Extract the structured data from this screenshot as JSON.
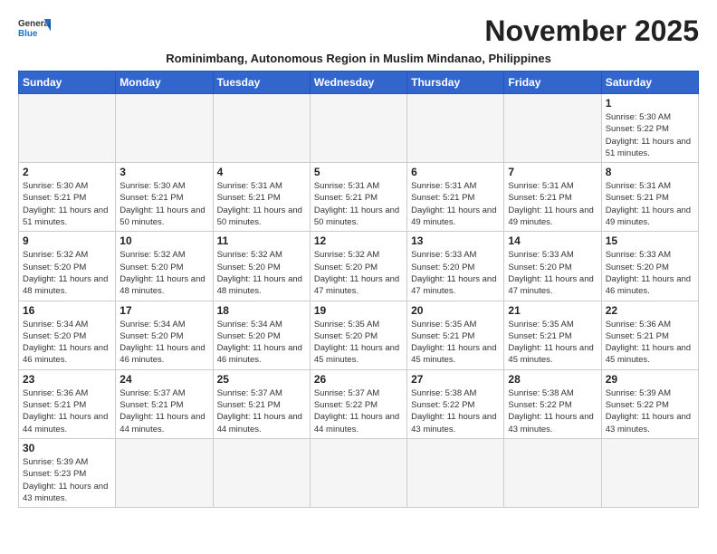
{
  "header": {
    "logo_general": "General",
    "logo_blue": "Blue",
    "month_title": "November 2025",
    "subtitle": "Rominimbang, Autonomous Region in Muslim Mindanao, Philippines"
  },
  "days_of_week": [
    "Sunday",
    "Monday",
    "Tuesday",
    "Wednesday",
    "Thursday",
    "Friday",
    "Saturday"
  ],
  "weeks": [
    [
      {
        "day": "",
        "info": ""
      },
      {
        "day": "",
        "info": ""
      },
      {
        "day": "",
        "info": ""
      },
      {
        "day": "",
        "info": ""
      },
      {
        "day": "",
        "info": ""
      },
      {
        "day": "",
        "info": ""
      },
      {
        "day": "1",
        "info": "Sunrise: 5:30 AM\nSunset: 5:22 PM\nDaylight: 11 hours and 51 minutes."
      }
    ],
    [
      {
        "day": "2",
        "info": "Sunrise: 5:30 AM\nSunset: 5:21 PM\nDaylight: 11 hours and 51 minutes."
      },
      {
        "day": "3",
        "info": "Sunrise: 5:30 AM\nSunset: 5:21 PM\nDaylight: 11 hours and 50 minutes."
      },
      {
        "day": "4",
        "info": "Sunrise: 5:31 AM\nSunset: 5:21 PM\nDaylight: 11 hours and 50 minutes."
      },
      {
        "day": "5",
        "info": "Sunrise: 5:31 AM\nSunset: 5:21 PM\nDaylight: 11 hours and 50 minutes."
      },
      {
        "day": "6",
        "info": "Sunrise: 5:31 AM\nSunset: 5:21 PM\nDaylight: 11 hours and 49 minutes."
      },
      {
        "day": "7",
        "info": "Sunrise: 5:31 AM\nSunset: 5:21 PM\nDaylight: 11 hours and 49 minutes."
      },
      {
        "day": "8",
        "info": "Sunrise: 5:31 AM\nSunset: 5:21 PM\nDaylight: 11 hours and 49 minutes."
      }
    ],
    [
      {
        "day": "9",
        "info": "Sunrise: 5:32 AM\nSunset: 5:20 PM\nDaylight: 11 hours and 48 minutes."
      },
      {
        "day": "10",
        "info": "Sunrise: 5:32 AM\nSunset: 5:20 PM\nDaylight: 11 hours and 48 minutes."
      },
      {
        "day": "11",
        "info": "Sunrise: 5:32 AM\nSunset: 5:20 PM\nDaylight: 11 hours and 48 minutes."
      },
      {
        "day": "12",
        "info": "Sunrise: 5:32 AM\nSunset: 5:20 PM\nDaylight: 11 hours and 47 minutes."
      },
      {
        "day": "13",
        "info": "Sunrise: 5:33 AM\nSunset: 5:20 PM\nDaylight: 11 hours and 47 minutes."
      },
      {
        "day": "14",
        "info": "Sunrise: 5:33 AM\nSunset: 5:20 PM\nDaylight: 11 hours and 47 minutes."
      },
      {
        "day": "15",
        "info": "Sunrise: 5:33 AM\nSunset: 5:20 PM\nDaylight: 11 hours and 46 minutes."
      }
    ],
    [
      {
        "day": "16",
        "info": "Sunrise: 5:34 AM\nSunset: 5:20 PM\nDaylight: 11 hours and 46 minutes."
      },
      {
        "day": "17",
        "info": "Sunrise: 5:34 AM\nSunset: 5:20 PM\nDaylight: 11 hours and 46 minutes."
      },
      {
        "day": "18",
        "info": "Sunrise: 5:34 AM\nSunset: 5:20 PM\nDaylight: 11 hours and 46 minutes."
      },
      {
        "day": "19",
        "info": "Sunrise: 5:35 AM\nSunset: 5:20 PM\nDaylight: 11 hours and 45 minutes."
      },
      {
        "day": "20",
        "info": "Sunrise: 5:35 AM\nSunset: 5:21 PM\nDaylight: 11 hours and 45 minutes."
      },
      {
        "day": "21",
        "info": "Sunrise: 5:35 AM\nSunset: 5:21 PM\nDaylight: 11 hours and 45 minutes."
      },
      {
        "day": "22",
        "info": "Sunrise: 5:36 AM\nSunset: 5:21 PM\nDaylight: 11 hours and 45 minutes."
      }
    ],
    [
      {
        "day": "23",
        "info": "Sunrise: 5:36 AM\nSunset: 5:21 PM\nDaylight: 11 hours and 44 minutes."
      },
      {
        "day": "24",
        "info": "Sunrise: 5:37 AM\nSunset: 5:21 PM\nDaylight: 11 hours and 44 minutes."
      },
      {
        "day": "25",
        "info": "Sunrise: 5:37 AM\nSunset: 5:21 PM\nDaylight: 11 hours and 44 minutes."
      },
      {
        "day": "26",
        "info": "Sunrise: 5:37 AM\nSunset: 5:22 PM\nDaylight: 11 hours and 44 minutes."
      },
      {
        "day": "27",
        "info": "Sunrise: 5:38 AM\nSunset: 5:22 PM\nDaylight: 11 hours and 43 minutes."
      },
      {
        "day": "28",
        "info": "Sunrise: 5:38 AM\nSunset: 5:22 PM\nDaylight: 11 hours and 43 minutes."
      },
      {
        "day": "29",
        "info": "Sunrise: 5:39 AM\nSunset: 5:22 PM\nDaylight: 11 hours and 43 minutes."
      }
    ],
    [
      {
        "day": "30",
        "info": "Sunrise: 5:39 AM\nSunset: 5:23 PM\nDaylight: 11 hours and 43 minutes."
      },
      {
        "day": "",
        "info": ""
      },
      {
        "day": "",
        "info": ""
      },
      {
        "day": "",
        "info": ""
      },
      {
        "day": "",
        "info": ""
      },
      {
        "day": "",
        "info": ""
      },
      {
        "day": "",
        "info": ""
      }
    ]
  ]
}
